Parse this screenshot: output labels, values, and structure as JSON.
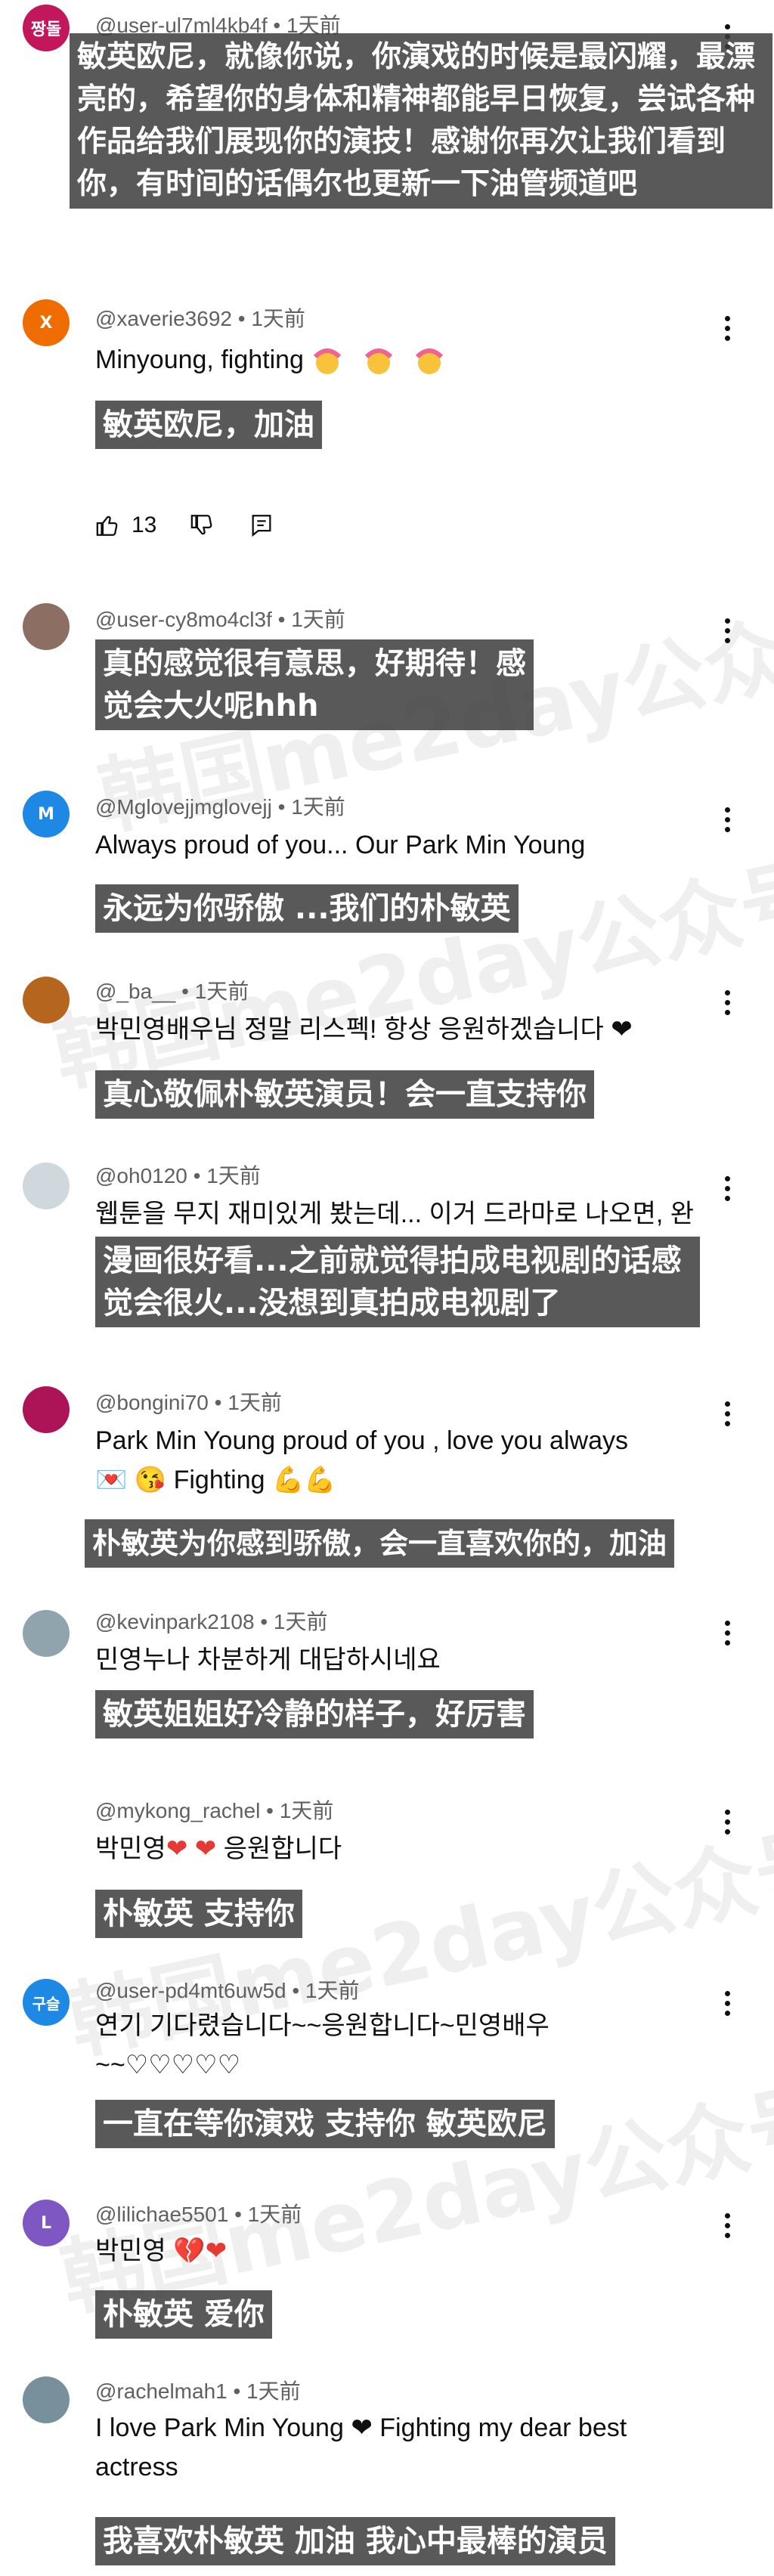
{
  "comments": [
    {
      "handle": "@user-ul7ml4kb4f",
      "time": "1天前",
      "avatar_label": "짱돌",
      "avatar_color": "#c2185b",
      "text": "",
      "caption": "敏英欧尼，就像你说，你演戏的时候是最闪耀，最漂亮的，希望你的身体和精神都能早日恢复，尝试各种作品给我们展现你的演技！感谢你再次让我们看到你，有时间的话偶尔也更新一下油管频道吧"
    },
    {
      "handle": "@xaverie3692",
      "time": "1天前",
      "avatar_label": "X",
      "avatar_color": "#ef6c00",
      "text": "Minyoung, fighting",
      "caption": "敏英欧尼，加油",
      "likes": "13"
    },
    {
      "handle": "@user-cy8mo4cl3f",
      "time": "1天前",
      "avatar_label": "",
      "avatar_color": "#8d6e63",
      "text": "",
      "caption": "真的感觉很有意思，好期待！感觉会大火呢hhh"
    },
    {
      "handle": "@Mglovejjmglovejj",
      "time": "1天前",
      "avatar_label": "M",
      "avatar_color": "#1e88e5",
      "text": "Always proud of you... Our Park Min Young",
      "caption": "永远为你骄傲 ...我们的朴敏英"
    },
    {
      "handle": "@_ba__",
      "time": "1天前",
      "avatar_label": "",
      "avatar_color": "#b5651d",
      "text": "박민영배우님 정말 리스펙! 항상 응원하겠습니다 ❤",
      "caption": "真心敬佩朴敏英演员！会一直支持你"
    },
    {
      "handle": "@oh0120",
      "time": "1天前",
      "avatar_label": "",
      "avatar_color": "#cfd8dc",
      "text": "웹툰을 무지 재미있게 봤는데... 이거 드라마로 나오면, 완",
      "caption": "漫画很好看...之前就觉得拍成电视剧的话感觉会很火...没想到真拍成电视剧了"
    },
    {
      "handle": "@bongini70",
      "time": "1天前",
      "avatar_label": "",
      "avatar_color": "#ad1457",
      "text": "Park Min Young proud of you , love you always",
      "text2": "Fighting",
      "caption": "朴敏英为你感到骄傲，会一直喜欢你的，加油"
    },
    {
      "handle": "@kevinpark2108",
      "time": "1天前",
      "avatar_label": "",
      "avatar_color": "#90a4ae",
      "text": "민영누나 차분하게 대답하시네요",
      "caption": "敏英姐姐好冷静的样子，好厉害"
    },
    {
      "handle": "@mykong_rachel",
      "time": "1天前",
      "avatar_label": "",
      "avatar_color": "#ffffff",
      "text": "박민영",
      "text2": "응원합니다",
      "caption": "朴敏英 支持你"
    },
    {
      "handle": "@user-pd4mt6uw5d",
      "time": "1天前",
      "avatar_label": "구슬",
      "avatar_color": "#1e88e5",
      "text": "연기 기다렸습니다~~응원합니다~민영배우",
      "text2": "~~♡♡♡♡♡",
      "caption": "一直在等你演戏 支持你 敏英欧尼"
    },
    {
      "handle": "@lilichae5501",
      "time": "1天前",
      "avatar_label": "L",
      "avatar_color": "#7e57c2",
      "text": "박민영",
      "caption": "朴敏英 爱你"
    },
    {
      "handle": "@rachelmah1",
      "time": "1天前",
      "avatar_label": "",
      "avatar_color": "#78909c",
      "text": "I love Park Min Young ❤ Fighting my dear best actress",
      "caption": "我喜欢朴敏英 加油 我心中最棒的演员"
    }
  ],
  "watermark": "韩国me2day公众号",
  "colors": {
    "heart": "#e53935",
    "caption_bg": "#3c3c3c"
  }
}
